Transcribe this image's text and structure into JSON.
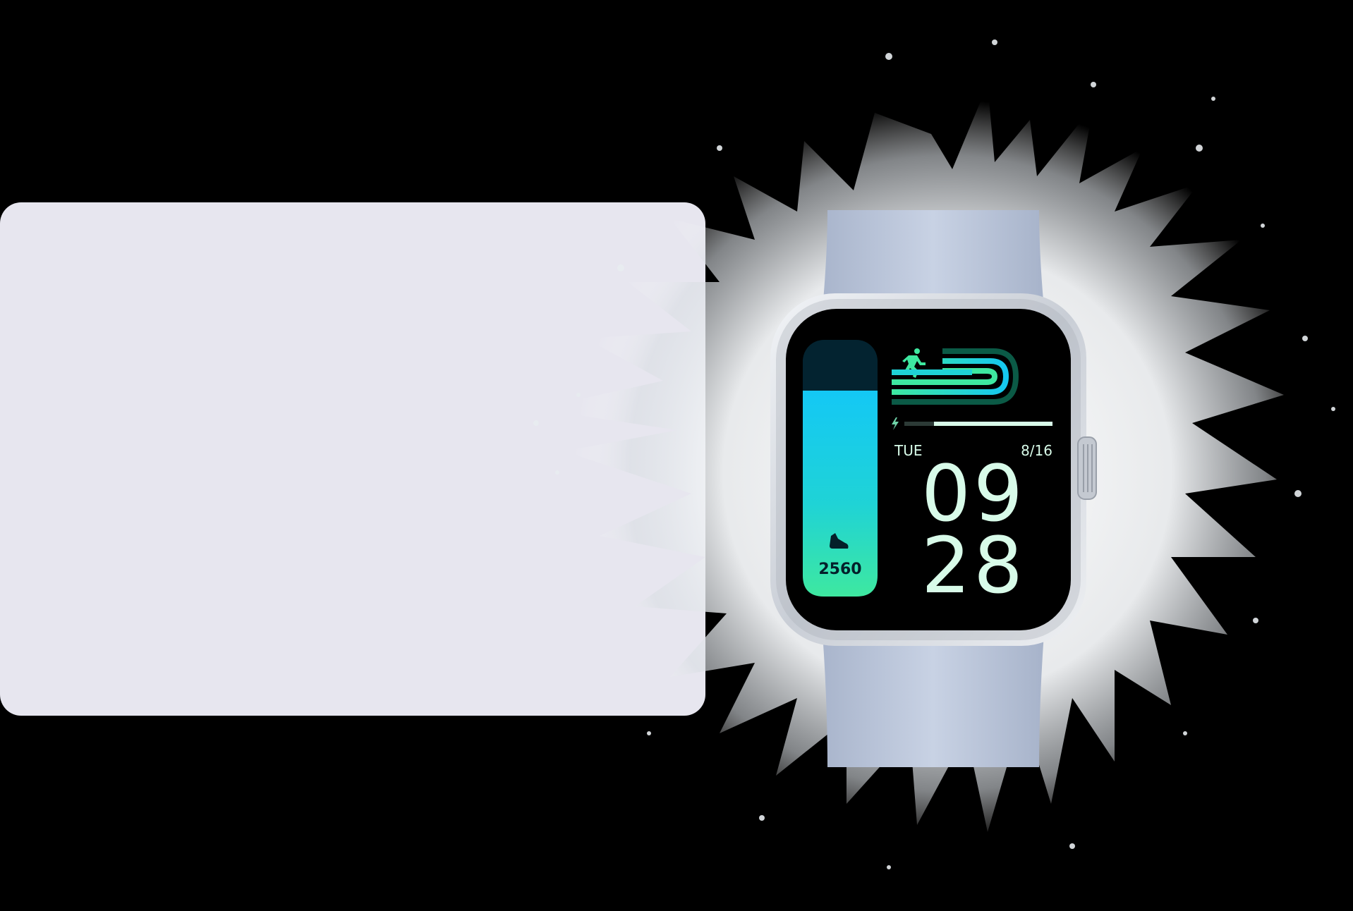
{
  "watch": {
    "steps": "2560",
    "day": "TUE",
    "date": "8/16",
    "hour": "09",
    "minute": "28"
  },
  "colors": {
    "panel": "#e7e6ef",
    "strap": "#c3cde0",
    "case": "#d9dde4",
    "screen": "#000000",
    "accent_green": "#3ee8a0",
    "accent_cyan": "#15c8f0",
    "digits": "#d8fbe9"
  },
  "icons": [
    "running-figure-icon",
    "shoe-icon",
    "lightning-icon"
  ]
}
